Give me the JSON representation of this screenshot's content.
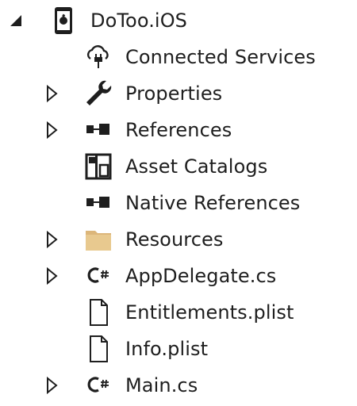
{
  "tree": {
    "root": {
      "label": "DoToo.iOS",
      "expander": "expanded",
      "icon": "ios-project-icon"
    },
    "items": [
      {
        "label": "Connected Services",
        "icon": "connected-services-icon",
        "expander": "none"
      },
      {
        "label": "Properties",
        "icon": "wrench-icon",
        "expander": "collapsed"
      },
      {
        "label": "References",
        "icon": "references-icon",
        "expander": "collapsed"
      },
      {
        "label": "Asset Catalogs",
        "icon": "asset-catalog-icon",
        "expander": "none"
      },
      {
        "label": "Native References",
        "icon": "references-icon",
        "expander": "none"
      },
      {
        "label": "Resources",
        "icon": "folder-icon",
        "expander": "collapsed"
      },
      {
        "label": "AppDelegate.cs",
        "icon": "csharp-file-icon",
        "expander": "collapsed"
      },
      {
        "label": "Entitlements.plist",
        "icon": "file-icon",
        "expander": "none"
      },
      {
        "label": "Info.plist",
        "icon": "file-icon",
        "expander": "none"
      },
      {
        "label": "Main.cs",
        "icon": "csharp-file-icon",
        "expander": "collapsed"
      }
    ]
  },
  "colors": {
    "text": "#1e1e1e",
    "icon_dark": "#212121",
    "folder": "#dcb67a",
    "background": "#ffffff"
  }
}
